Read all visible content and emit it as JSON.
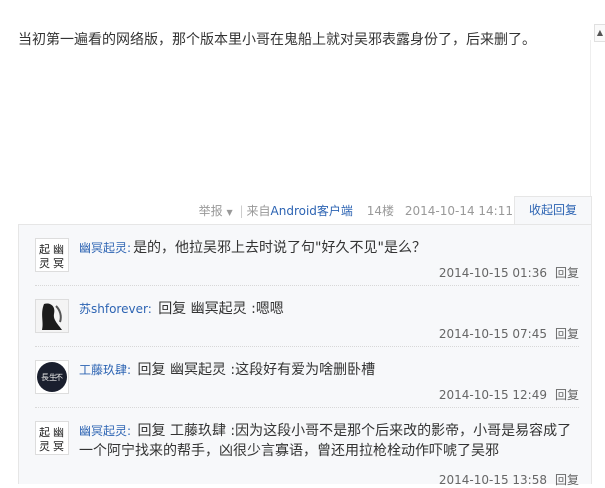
{
  "post": {
    "text": "当初第一遍看的网络版，那个版本里小哥在鬼船上就对吴邪表露身份了，后来删了。"
  },
  "tail": {
    "report_label": "举报",
    "source_prefix": "来自",
    "source_client": "Android客户端",
    "floor": "14楼",
    "time": "2014-10-14 14:11",
    "collapse_label": "收起回复"
  },
  "replies": [
    {
      "user": "幽冥起灵",
      "text": "是的，他拉吴邪上去时说了句\"好久不见\"是么？",
      "time": "2014-10-15 01:36",
      "reply_label": "回复"
    },
    {
      "user": "苏shforever",
      "prefix": "回复",
      "target": "幽冥起灵",
      "text": "嗯嗯",
      "time": "2014-10-15 07:45",
      "reply_label": "回复"
    },
    {
      "user": "工藤玖肆",
      "prefix": "回复",
      "target": "幽冥起灵",
      "text": "这段好有爱为啥删卧槽",
      "time": "2014-10-15 12:49",
      "reply_label": "回复"
    },
    {
      "user": "幽冥起灵",
      "prefix": "回复",
      "target": "工藤玖肆",
      "text": "因为这段小哥不是那个后来改的影帝，小哥是易容成了一个阿宁找来的帮手，凶很少言寡语，曾还用拉枪栓动作吓唬了吴邪",
      "time": "2014-10-15 13:58",
      "reply_label": "回复"
    }
  ]
}
